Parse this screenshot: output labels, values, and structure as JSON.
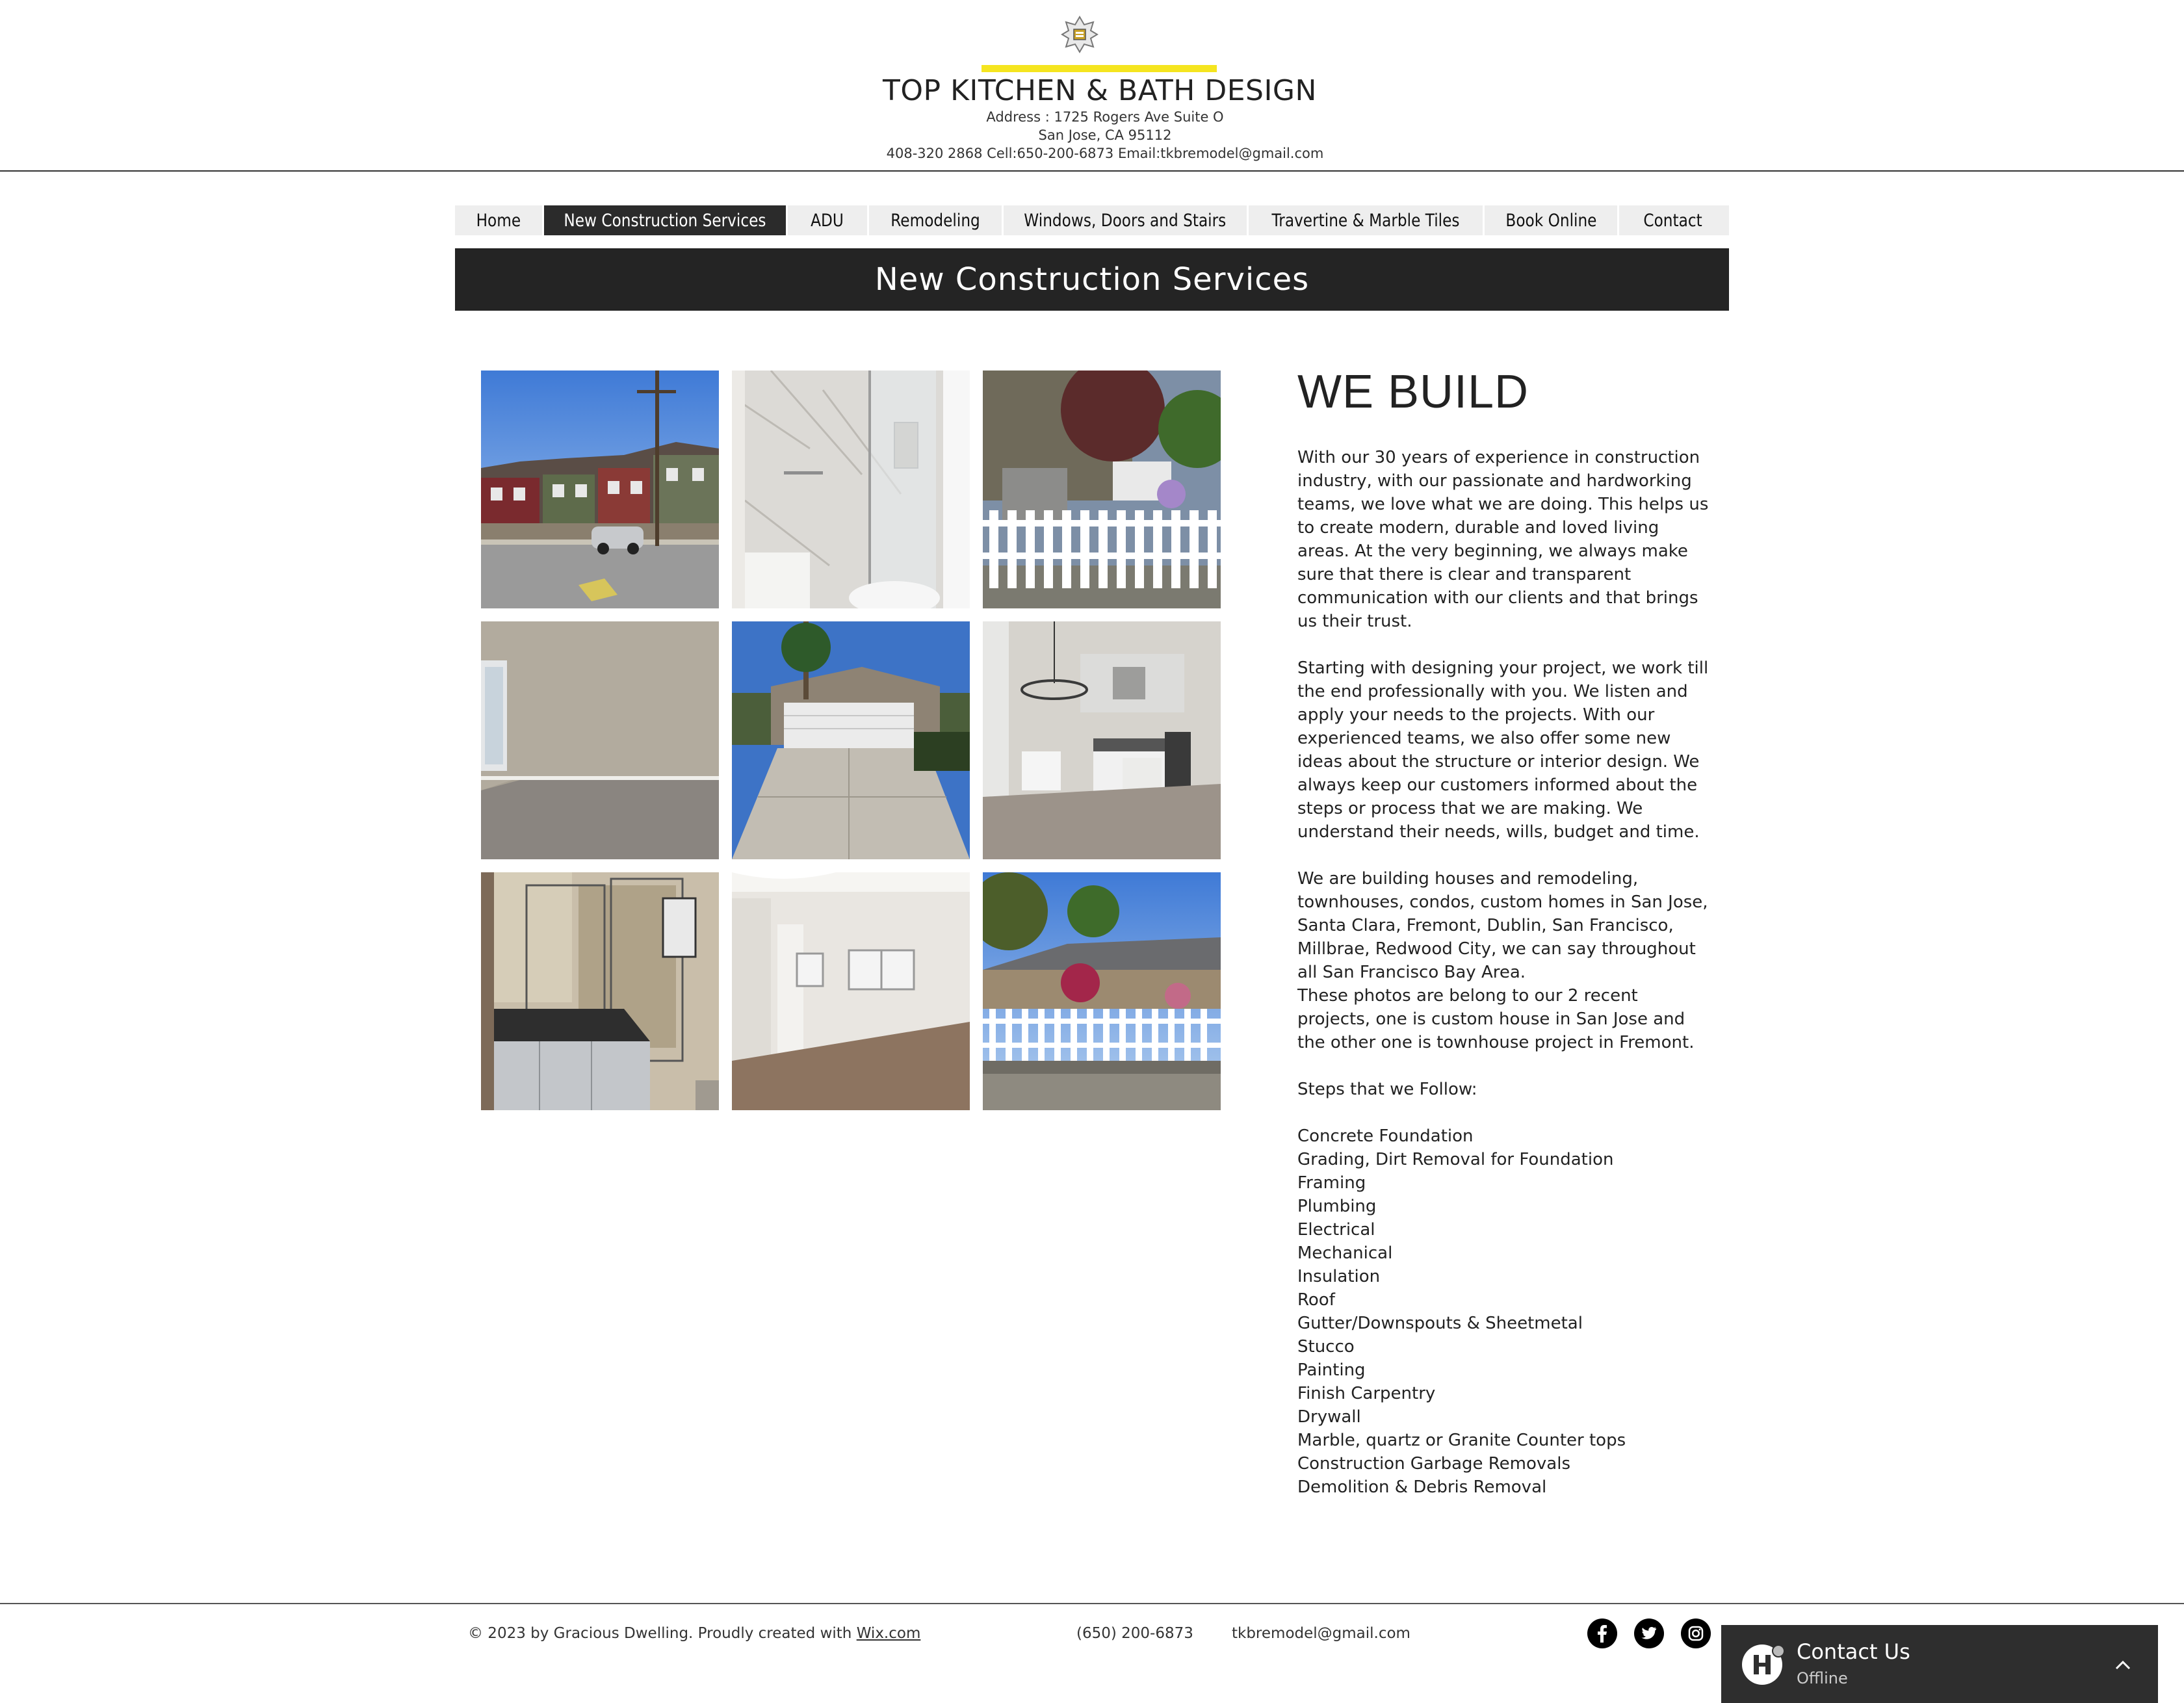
{
  "header": {
    "title": "TOP KITCHEN & BATH DESIGN",
    "address_line1": "Address : 1725 Rogers Ave Suite O",
    "address_line2": "San Jose, CA 95112",
    "contact_line": "408-320 2868 Cell:650-200-6873 Email:tkbremodel@gmail.com",
    "accent_color": "#f5e51f"
  },
  "nav": {
    "items": [
      {
        "label": "Home"
      },
      {
        "label": "New Construction Services",
        "active": true
      },
      {
        "label": "ADU"
      },
      {
        "label": "Remodeling"
      },
      {
        "label": "Windows, Doors and Stairs"
      },
      {
        "label": "Travertine & Marble Tiles"
      },
      {
        "label": "Book Online"
      },
      {
        "label": "Contact"
      }
    ]
  },
  "banner": {
    "title": "New Construction Services"
  },
  "gallery": {
    "photos": [
      {
        "icon": "townhouses-photo"
      },
      {
        "icon": "marble-shower-photo"
      },
      {
        "icon": "porch-fence-photo"
      },
      {
        "icon": "empty-room-photo"
      },
      {
        "icon": "garage-driveway-photo"
      },
      {
        "icon": "kitchen-photo"
      },
      {
        "icon": "bathroom-vanity-photo"
      },
      {
        "icon": "living-room-photo"
      },
      {
        "icon": "house-fence-photo"
      }
    ]
  },
  "content": {
    "heading": "WE BUILD",
    "paragraph1": "With our 30 years of experience in construction industry, with our passionate and hardworking teams, we love what we are doing. This helps us to create modern, durable and loved living areas. At the very beginning, we always make sure that there is clear and transparent communication with our clients and that brings us their trust.",
    "paragraph2": "Starting with designing your project, we work till the end professionally with you. We listen and apply your needs to the projects. With our experienced teams, we also offer some new ideas about the structure or interior design. We always keep our customers informed about the steps or process that we are making. We understand their needs, wills, budget and time.",
    "paragraph3": "We are building houses and remodeling, townhouses, condos, custom homes in San Jose, Santa Clara, Fremont, Dublin, San Francisco, Millbrae, Redwood City, we can say throughout all San Francisco Bay Area.",
    "paragraph4": "These photos are belong to our 2 recent projects, one is custom house in San Jose and the other one is townhouse project in Fremont.",
    "steps_heading": "Steps that we Follow:",
    "steps": [
      "Concrete Foundation",
      "Grading, Dirt Removal for Foundation",
      "Framing",
      "Plumbing",
      "Electrical",
      "Mechanical",
      "Insulation",
      "Roof",
      "Gutter/Downspouts & Sheetmetal",
      "Stucco",
      "Painting",
      "Finish Carpentry",
      "Drywall",
      "Marble, quartz or Granite Counter tops",
      "Construction Garbage Removals",
      "Demolition & Debris Removal"
    ]
  },
  "footer": {
    "copyright_prefix": "© 2023 by Gracious Dwelling. Proudly created with ",
    "copyright_link": "Wix.com",
    "phone": "(650) 200-6873",
    "email": "tkbremodel@gmail.com",
    "social": [
      "facebook-icon",
      "twitter-icon",
      "instagram-icon"
    ]
  },
  "chat": {
    "title": "Contact Us",
    "status": "Offline"
  }
}
